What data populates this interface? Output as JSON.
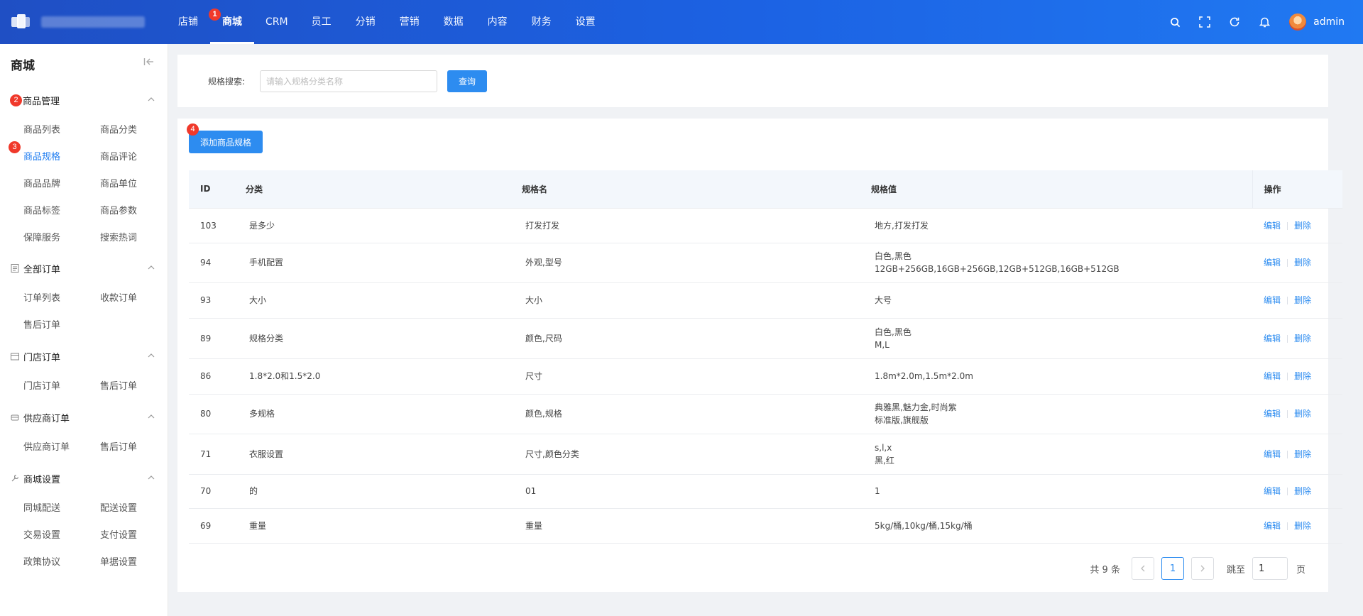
{
  "topnav": {
    "items": [
      "店铺",
      "商城",
      "CRM",
      "员工",
      "分销",
      "营销",
      "数据",
      "内容",
      "财务",
      "设置"
    ],
    "active": "商城",
    "user": "admin"
  },
  "badges": [
    "1",
    "2",
    "3",
    "4"
  ],
  "sidebar": {
    "title": "商城",
    "groups": [
      {
        "label": "商品管理",
        "items": [
          "商品列表",
          "商品分类",
          "商品规格",
          "商品评论",
          "商品品牌",
          "商品单位",
          "商品标签",
          "商品参数",
          "保障服务",
          "搜索热词"
        ]
      },
      {
        "label": "全部订单",
        "items": [
          "订单列表",
          "收款订单",
          "售后订单"
        ]
      },
      {
        "label": "门店订单",
        "items": [
          "门店订单",
          "售后订单"
        ]
      },
      {
        "label": "供应商订单",
        "items": [
          "供应商订单",
          "售后订单"
        ]
      },
      {
        "label": "商城设置",
        "items": [
          "同城配送",
          "配送设置",
          "交易设置",
          "支付设置",
          "政策协议",
          "单据设置"
        ]
      }
    ],
    "active_item": "商品规格"
  },
  "search": {
    "label": "规格搜索:",
    "placeholder": "请输入规格分类名称",
    "button": "查询"
  },
  "add_button": "添加商品规格",
  "table": {
    "headers": [
      "ID",
      "分类",
      "规格名",
      "规格值",
      "操作"
    ],
    "rows": [
      {
        "id": "103",
        "category": "是多少",
        "name": "打发打发",
        "values": [
          "地方,打发打发"
        ]
      },
      {
        "id": "94",
        "category": "手机配置",
        "name": "外观,型号",
        "values": [
          "白色,黑色",
          "12GB+256GB,16GB+256GB,12GB+512GB,16GB+512GB"
        ]
      },
      {
        "id": "93",
        "category": "大小",
        "name": "大小",
        "values": [
          "大号"
        ]
      },
      {
        "id": "89",
        "category": "规格分类",
        "name": "颜色,尺码",
        "values": [
          "白色,黑色",
          "M,L"
        ]
      },
      {
        "id": "86",
        "category": "1.8*2.0和1.5*2.0",
        "name": "尺寸",
        "values": [
          "1.8m*2.0m,1.5m*2.0m"
        ]
      },
      {
        "id": "80",
        "category": "多规格",
        "name": "颜色,规格",
        "values": [
          "典雅黑,魅力金,时尚紫",
          "标准版,旗舰版"
        ]
      },
      {
        "id": "71",
        "category": "衣服设置",
        "name": "尺寸,颜色分类",
        "values": [
          "s,l,x",
          "黑,红"
        ]
      },
      {
        "id": "70",
        "category": "的",
        "name": "01",
        "values": [
          "1"
        ]
      },
      {
        "id": "69",
        "category": "重量",
        "name": "重量",
        "values": [
          "5kg/桶,10kg/桶,15kg/桶"
        ]
      }
    ],
    "actions": {
      "edit": "编辑",
      "delete": "删除"
    }
  },
  "pagination": {
    "total_text": "共 9 条",
    "current_page": "1",
    "jump_label": "跳至",
    "jump_value": "1",
    "page_suffix": "页"
  },
  "colors": {
    "primary": "#2d8cf0",
    "header_start": "#1f4fc4",
    "header_end": "#2079f2",
    "badge": "#f0392b"
  }
}
